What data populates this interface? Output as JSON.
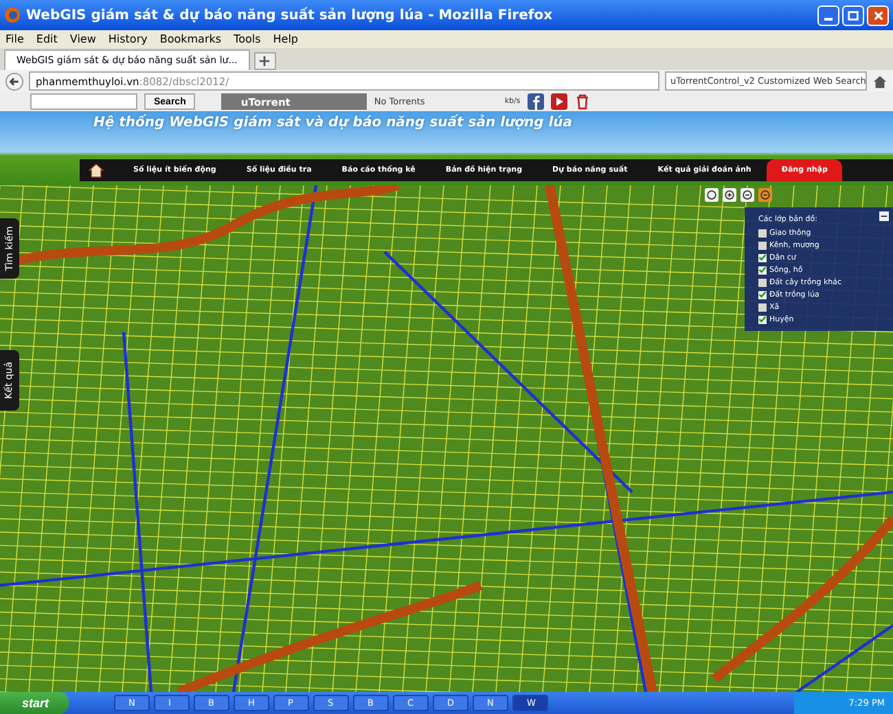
{
  "window": {
    "title": "WebGIS giám sát & dự báo năng suất sản lượng lúa - Mozilla Firefox"
  },
  "menu_bar": [
    "File",
    "Edit",
    "View",
    "History",
    "Bookmarks",
    "Tools",
    "Help"
  ],
  "tabs": [
    {
      "label": "WebGIS giám sát & dự báo năng suất sản lư...",
      "selected": true
    }
  ],
  "address_bar": {
    "host": "phanmemthuyloi.vn",
    "rest": ":8082/dbscl2012/"
  },
  "web_search": {
    "value": "uTorrentControl_v2 Customized Web Search"
  },
  "toolbar": {
    "search_button": "Search",
    "utorrent_label": "uTorrent",
    "torrent_status": "No Torrents",
    "speed": "kb/s"
  },
  "site": {
    "title": "Hệ thống WebGIS giám sát và dự báo năng suất sản lượng lúa",
    "nav": [
      {
        "label": "Số liệu ít biến động",
        "selected": false
      },
      {
        "label": "Số liệu điều tra",
        "selected": false
      },
      {
        "label": "Báo cáo thống kê",
        "selected": false
      },
      {
        "label": "Bản đồ hiện trạng",
        "selected": false
      },
      {
        "label": "Dự báo năng suất",
        "selected": false
      },
      {
        "label": "Kết quả giải đoán ảnh",
        "selected": false
      },
      {
        "label": "Đăng nhập",
        "selected": true
      }
    ]
  },
  "side_tabs": [
    "Tìm kiếm",
    "Kết quả"
  ],
  "layers": {
    "title": "Các lớp bản đồ:",
    "items": [
      {
        "label": "Giao thông",
        "checked": false
      },
      {
        "label": "Kênh, mương",
        "checked": false
      },
      {
        "label": "Dân cư",
        "checked": true
      },
      {
        "label": "Sông, hồ",
        "checked": true
      },
      {
        "label": "Đất cây trồng khác",
        "checked": false
      },
      {
        "label": "Đất trồng lúa",
        "checked": true
      },
      {
        "label": "Xã",
        "checked": false
      },
      {
        "label": "Huyện",
        "checked": true
      }
    ]
  },
  "taskbar": {
    "start": "start",
    "items": [
      {
        "label": "N",
        "selected": false
      },
      {
        "label": "I",
        "selected": false
      },
      {
        "label": "B",
        "selected": false
      },
      {
        "label": "H",
        "selected": false
      },
      {
        "label": "P",
        "selected": false
      },
      {
        "label": "S",
        "selected": false
      },
      {
        "label": "B",
        "selected": false
      },
      {
        "label": "C",
        "selected": false
      },
      {
        "label": "D",
        "selected": false
      },
      {
        "label": "N",
        "selected": false
      },
      {
        "label": "W",
        "selected": true
      }
    ],
    "clock": "7:29 PM"
  }
}
